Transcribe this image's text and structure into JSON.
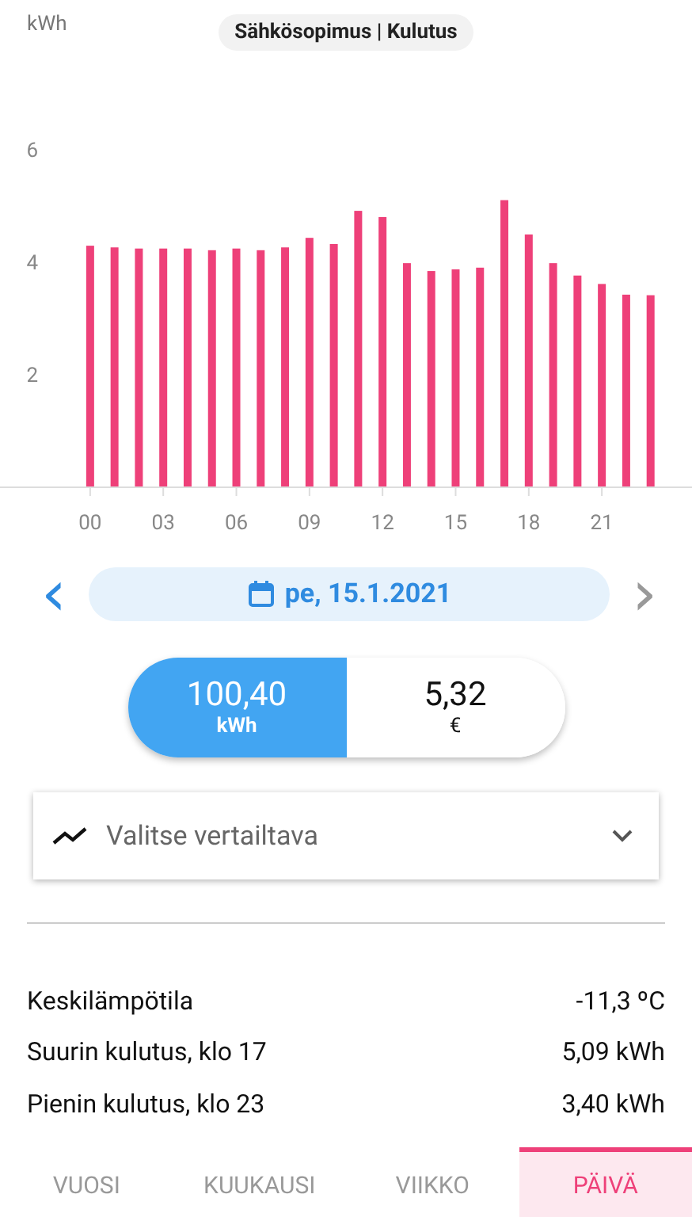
{
  "header": {
    "title": "Sähkösopimus | Kulutus"
  },
  "chart": {
    "chart_data": {
      "type": "bar",
      "ylabel": "kWh",
      "x": [
        0,
        1,
        2,
        3,
        4,
        5,
        6,
        7,
        8,
        9,
        10,
        11,
        12,
        13,
        14,
        15,
        16,
        17,
        18,
        19,
        20,
        21,
        22,
        23
      ],
      "xlim": [
        -3.7,
        24.7
      ],
      "ylim": [
        0,
        6
      ],
      "series": [
        {
          "color": "#ee4079",
          "values": [
            4.28,
            4.25,
            4.23,
            4.23,
            4.23,
            4.2,
            4.23,
            4.2,
            4.25,
            4.42,
            4.31,
            4.9,
            4.79,
            3.97,
            3.83,
            3.86,
            3.89,
            5.09,
            4.48,
            3.97,
            3.75,
            3.6,
            3.41,
            3.4
          ]
        }
      ],
      "yticks": [
        {
          "value": 2,
          "label": "2"
        },
        {
          "value": 4,
          "label": "4"
        },
        {
          "value": 6,
          "label": "6"
        }
      ],
      "xticks": [
        {
          "value": 0,
          "label": "00"
        },
        {
          "value": 3,
          "label": "03"
        },
        {
          "value": 6,
          "label": "06"
        },
        {
          "value": 9,
          "label": "09"
        },
        {
          "value": 12,
          "label": "12"
        },
        {
          "value": 15,
          "label": "15"
        },
        {
          "value": 18,
          "label": "18"
        },
        {
          "value": 21,
          "label": "21"
        }
      ]
    }
  },
  "date_nav": {
    "prev": "‹",
    "date": "pe, 15.1.2021",
    "next": "›",
    "next_disabled": true
  },
  "totals": [
    {
      "value": "100,40",
      "unit": "kWh",
      "selected": true
    },
    {
      "value": "5,32",
      "unit": "€",
      "selected": false
    }
  ],
  "compare": {
    "placeholder": "Valitse vertailtava"
  },
  "stats": [
    {
      "label": "Keskilämpötila",
      "value": "-11,3 ºC"
    },
    {
      "label": "Suurin kulutus, klo 17",
      "value": "5,09 kWh"
    },
    {
      "label": "Pienin kulutus, klo 23",
      "value": "3,40 kWh"
    }
  ],
  "tabs": [
    {
      "label": "VUOSI",
      "selected": false
    },
    {
      "label": "KUUKAUSI",
      "selected": false
    },
    {
      "label": "VIIKKO",
      "selected": false
    },
    {
      "label": "PÄIVÄ",
      "selected": true
    }
  ]
}
